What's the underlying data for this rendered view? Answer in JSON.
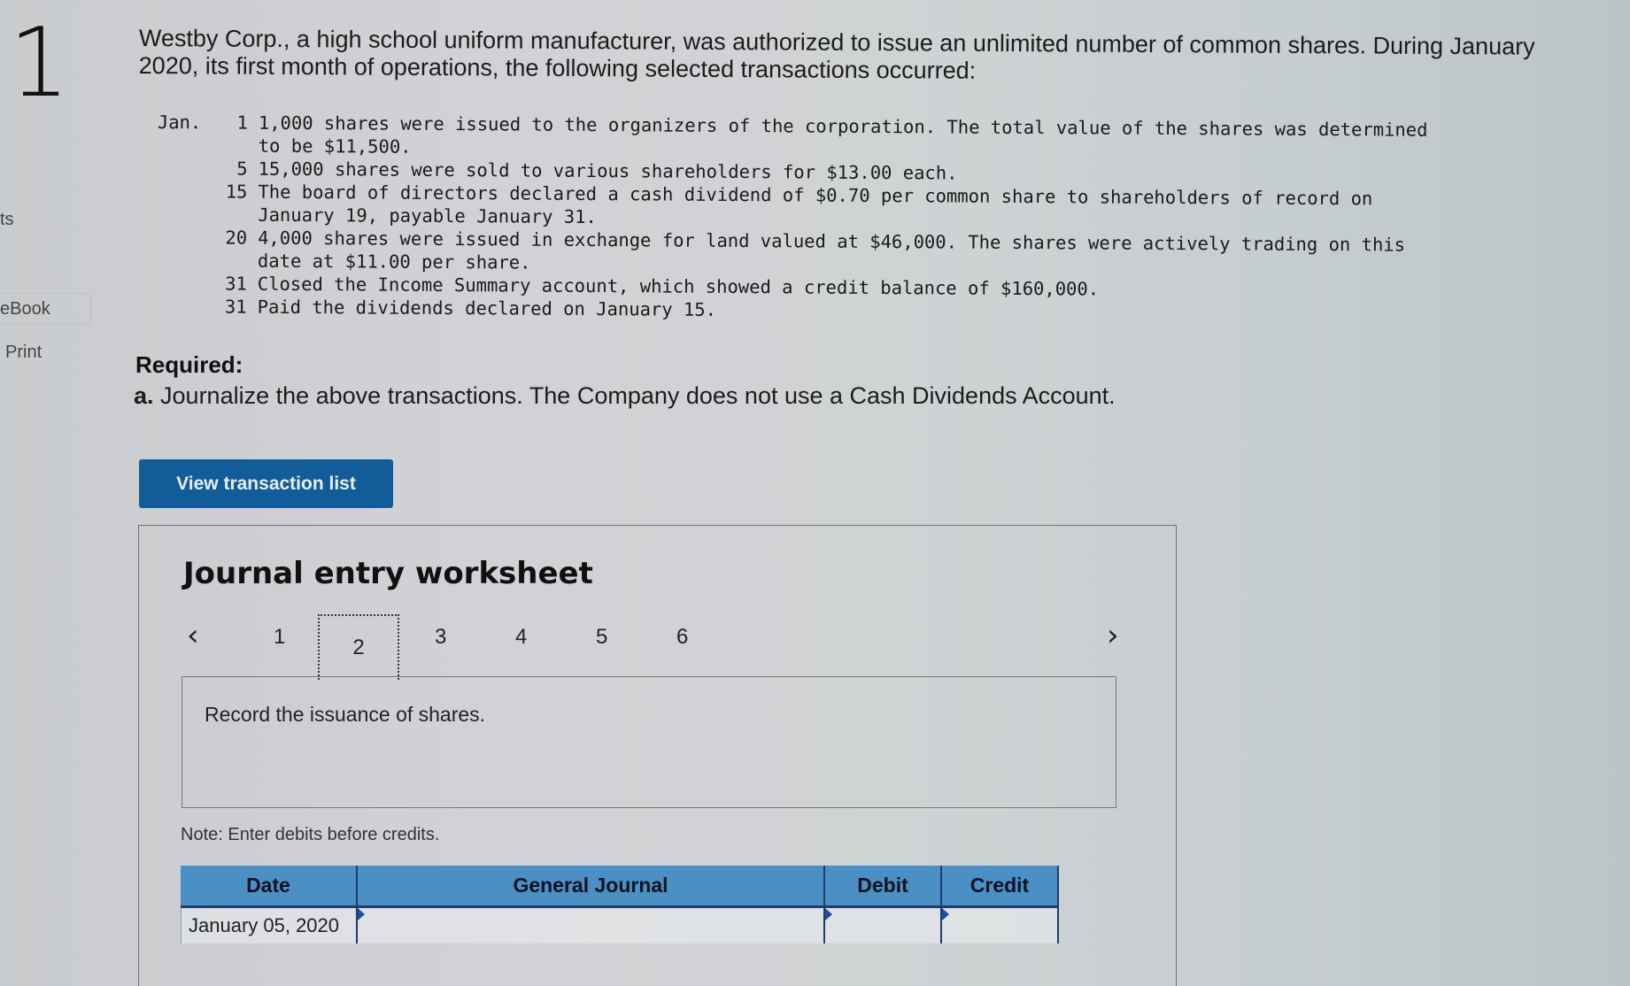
{
  "question_number": "1",
  "sidebar": {
    "items": [
      {
        "label": "ts"
      },
      {
        "label": "eBook"
      },
      {
        "label": "Print"
      }
    ]
  },
  "intro": {
    "text": "Westby Corp., a high school uniform manufacturer, was authorized to issue an unlimited number of common shares. During January 2020, its first month of operations, the following selected transactions occurred:"
  },
  "transactions": {
    "month": "Jan.",
    "rows": [
      {
        "day": "1",
        "text": "1,000 shares were issued to the organizers of the corporation. The total value of the shares was determined"
      },
      {
        "day": "",
        "text": "to be $11,500."
      },
      {
        "day": "5",
        "text": "15,000 shares were sold to various shareholders for $13.00 each."
      },
      {
        "day": "15",
        "text": "The board of directors declared a cash dividend of $0.70 per common share to shareholders of record on"
      },
      {
        "day": "",
        "text": "January 19, payable January 31."
      },
      {
        "day": "20",
        "text": "4,000 shares were issued in exchange for land valued at $46,000. The shares were actively trading on this"
      },
      {
        "day": "",
        "text": "date at $11.00 per share."
      },
      {
        "day": "31",
        "text": "Closed the Income Summary account, which showed a credit balance of $160,000."
      },
      {
        "day": "31",
        "text": "Paid the dividends declared on January 15."
      }
    ]
  },
  "required": {
    "label": "Required:",
    "part_letter": "a.",
    "part_text": " Journalize the above transactions. The Company does not use a Cash Dividends Account."
  },
  "buttons": {
    "view_transaction_list": "View transaction list"
  },
  "worksheet": {
    "title": "Journal entry worksheet",
    "prev_icon": "chevron-left-icon",
    "next_icon": "chevron-right-icon",
    "pages": [
      "1",
      "2",
      "3",
      "4",
      "5",
      "6"
    ],
    "current_page": "2",
    "instruction": "Record the issuance of shares.",
    "note": "Note: Enter debits before credits.",
    "table": {
      "headers": [
        "Date",
        "General Journal",
        "Debit",
        "Credit"
      ],
      "rows": [
        {
          "date": "January 05, 2020",
          "account": "",
          "debit": "",
          "credit": ""
        }
      ]
    }
  },
  "colors": {
    "button_bg": "#135c9a",
    "table_header": "#4a90c4",
    "table_border": "#1e3d6b"
  }
}
